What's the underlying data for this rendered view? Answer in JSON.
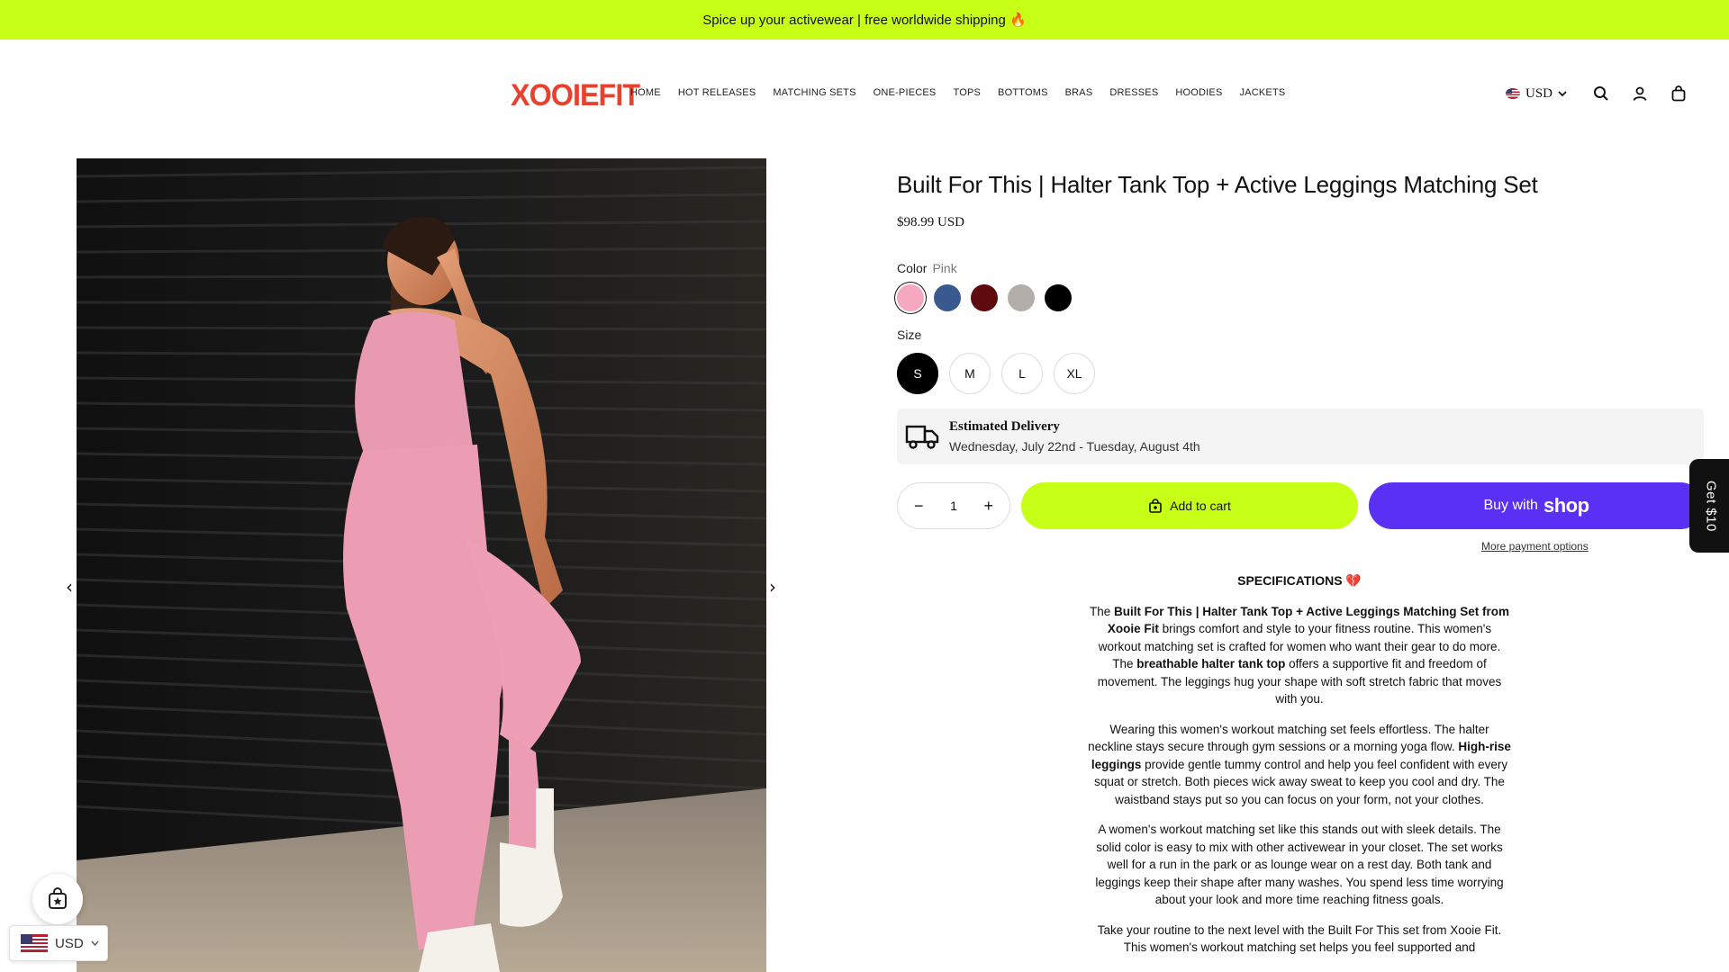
{
  "announcement": "Spice up your activewear | free worldwide shipping 🔥",
  "logo": "XOOIEFIT",
  "nav": [
    "HOME",
    "HOT RELEASES",
    "MATCHING SETS",
    "ONE-PIECES",
    "TOPS",
    "BOTTOMS",
    "BRAS",
    "DRESSES",
    "HOODIES",
    "JACKETS"
  ],
  "header": {
    "currency": "USD"
  },
  "product": {
    "title": "Built For This | Halter Tank Top + Active Leggings Matching Set",
    "price": "$98.99 USD",
    "color_label": "Color",
    "color_value": "Pink",
    "colors": [
      {
        "name": "pink",
        "hex": "#f6a8c0"
      },
      {
        "name": "navy",
        "hex": "#3a5a8f"
      },
      {
        "name": "burgundy",
        "hex": "#5e0a0e"
      },
      {
        "name": "grey",
        "hex": "#b3aeaa"
      },
      {
        "name": "black",
        "hex": "#000000"
      }
    ],
    "size_label": "Size",
    "sizes": [
      "S",
      "M",
      "L",
      "XL"
    ],
    "selected_size": "S",
    "delivery_title": "Estimated Delivery",
    "delivery_dates": "Wednesday, July 22nd - Tuesday, August 4th",
    "quantity": "1",
    "add_to_cart": "Add to cart",
    "buy_with": "Buy with",
    "shop_brand": "shop",
    "more_payment": "More payment options"
  },
  "specs": {
    "heading": "SPECIFICATIONS 💔",
    "p1_a": "The ",
    "p1_b": "Built For This | Halter Tank Top + Active Leggings Matching Set from Xooie Fit",
    "p1_c": " brings comfort and style to your fitness routine. This women's workout matching set is crafted for women who want their gear to do more. The ",
    "p1_d": "breathable halter tank top",
    "p1_e": " offers a supportive fit and freedom of movement. The leggings hug your shape with soft stretch fabric that moves with you.",
    "p2_a": "Wearing this women's workout matching set feels effortless. The halter neckline stays secure through gym sessions or a morning yoga flow. ",
    "p2_b": "High-rise leggings",
    "p2_c": " provide gentle tummy control and help you feel confident with every squat or stretch. Both pieces wick away sweat to keep you cool and dry. The waistband stays put so you can focus on your form, not your clothes.",
    "p3": "A women's workout matching set like this stands out with sleek details. The solid color is easy to mix with other activewear in your closet. The set works well for a run in the park or as lounge wear on a rest day. Both tank and leggings keep their shape after many washes. You spend less time worrying about your look and more time reaching fitness goals.",
    "p4": "Take your routine to the next level with the Built For This set from Xooie Fit. This women's workout matching set helps you feel supported and"
  },
  "side_tab": "Get $10",
  "currency_widget": "USD"
}
